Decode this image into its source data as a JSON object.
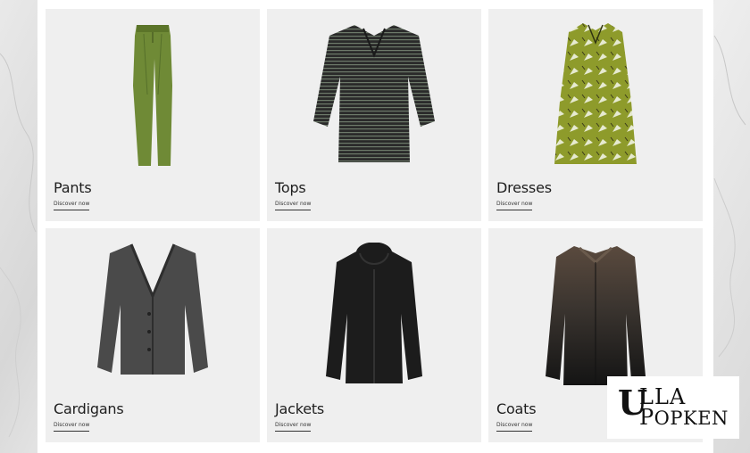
{
  "categories": [
    {
      "name": "Pants",
      "link": "Discover now",
      "icon": "pants-icon"
    },
    {
      "name": "Tops",
      "link": "Discover now",
      "icon": "top-icon"
    },
    {
      "name": "Dresses",
      "link": "Discover now",
      "icon": "dress-icon"
    },
    {
      "name": "Cardigans",
      "link": "Discover now",
      "icon": "cardigan-icon"
    },
    {
      "name": "Jackets",
      "link": "Discover now",
      "icon": "jacket-icon"
    },
    {
      "name": "Coats",
      "link": "Discover now",
      "icon": "coat-icon"
    }
  ],
  "brand": {
    "initial": "U",
    "line1_rest": "LLA",
    "line2_initial": "P",
    "line2_rest": "OPKEN"
  },
  "colors": {
    "card_bg": "#efefef",
    "pants_green": "#6f8a36",
    "dress_olive": "#8e9b2b",
    "dark_garment": "#1c1c1c"
  }
}
